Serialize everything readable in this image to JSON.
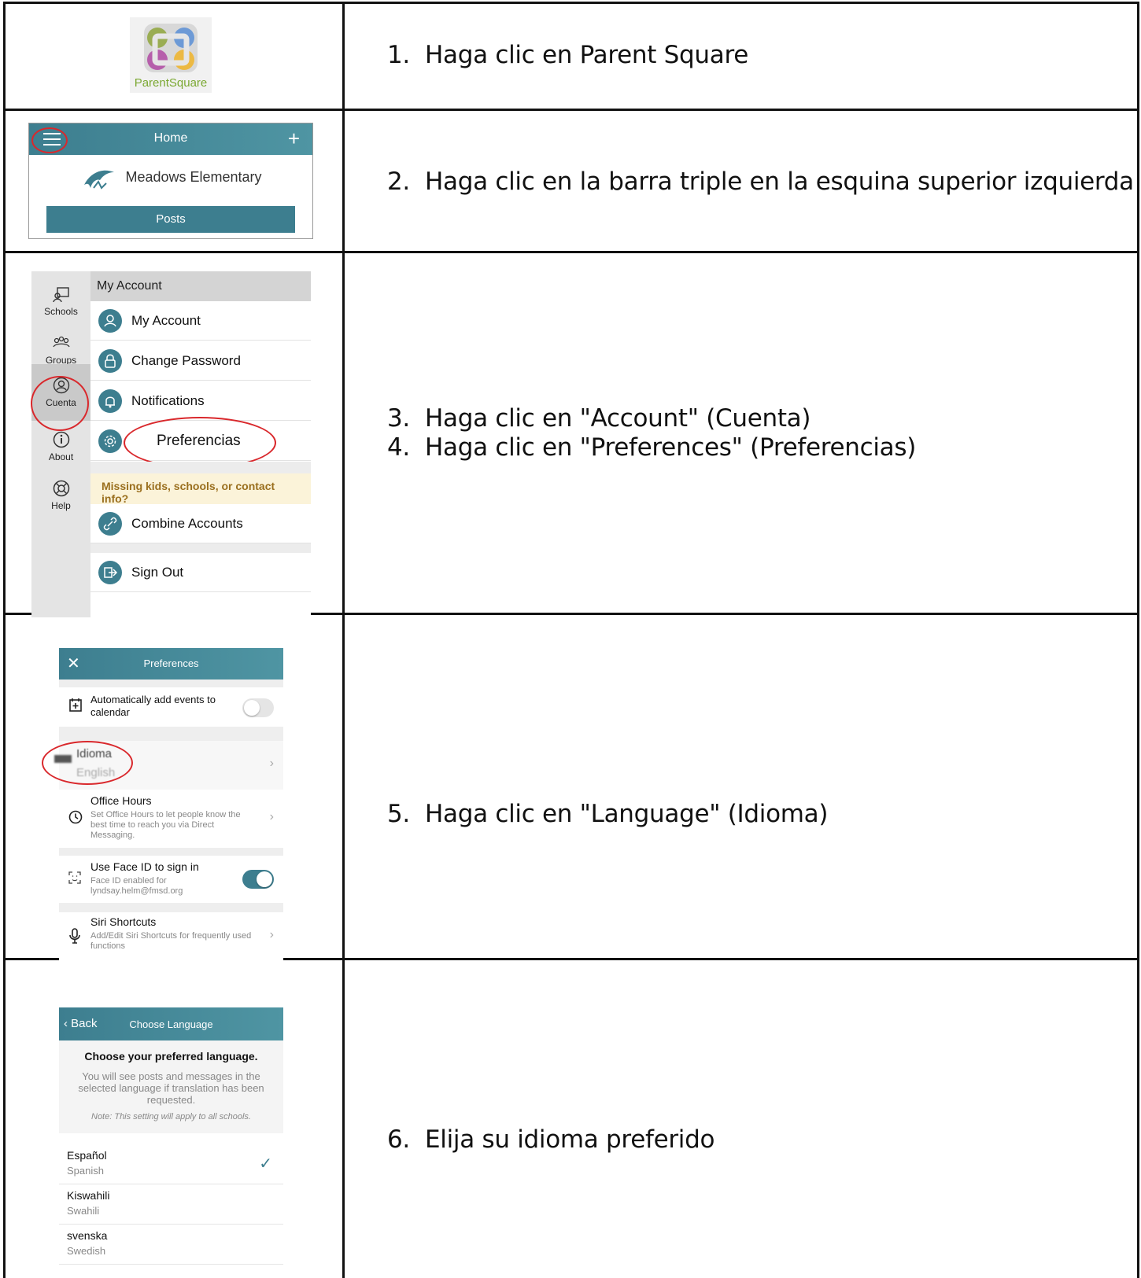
{
  "steps": [
    {
      "num": "1.",
      "text": "Haga clic en Parent Square"
    },
    {
      "num": "2.",
      "text": "Haga clic en la barra triple en la esquina superior izquierda"
    },
    {
      "num": "3.",
      "text": "Haga clic en \"Account\" (Cuenta)"
    },
    {
      "num": "4.",
      "text": "Haga clic en \"Preferences\" (Preferencias)"
    },
    {
      "num": "5.",
      "text": "Haga clic en \"Language\" (Idioma)"
    },
    {
      "num": "6.",
      "text": "Elija su idioma preferido"
    }
  ],
  "logo": {
    "text": "ParentSquare",
    "colors": [
      "#8a9c3a",
      "#5a8fd6",
      "#b04aa3",
      "#f0b429",
      "#4bb4b4"
    ]
  },
  "home_screen": {
    "title": "Home",
    "plus": "+",
    "school": "Meadows Elementary",
    "posts": "Posts"
  },
  "account_screen": {
    "sidebar": [
      {
        "label": "Schools"
      },
      {
        "label": "Groups"
      },
      {
        "label": "Cuenta"
      },
      {
        "label": "About"
      },
      {
        "label": "Help"
      }
    ],
    "header": "My Account",
    "items": [
      "My Account",
      "Change Password",
      "Notifications",
      "Preferencias"
    ],
    "warning": "Missing kids, schools, or contact info?",
    "combine": "Combine Accounts",
    "signout": "Sign Out"
  },
  "preferences_screen": {
    "title": "Preferences",
    "close": "✕",
    "auto_events": "Automatically add events to calendar",
    "idioma_title": "Idioma",
    "idioma_value": "English",
    "office_title": "Office Hours",
    "office_sub": "Set Office Hours to let people know the best time to reach you via Direct Messaging.",
    "faceid_title": "Use Face ID to sign in",
    "faceid_sub": "Face ID enabled for lyndsay.helm@fmsd.org",
    "siri_title": "Siri Shortcuts",
    "siri_sub": "Add/Edit Siri Shortcuts for frequently used functions"
  },
  "language_screen": {
    "back": "Back",
    "title": "Choose Language",
    "heading": "Choose your preferred language.",
    "desc": "You will see posts and messages in the selected language if translation has been requested.",
    "note": "Note: This setting will apply to all schools.",
    "languages": [
      {
        "name": "Español",
        "english": "Spanish",
        "selected": true
      },
      {
        "name": "Kiswahili",
        "english": "Swahili",
        "selected": false
      },
      {
        "name": "svenska",
        "english": "Swedish",
        "selected": false
      }
    ]
  }
}
